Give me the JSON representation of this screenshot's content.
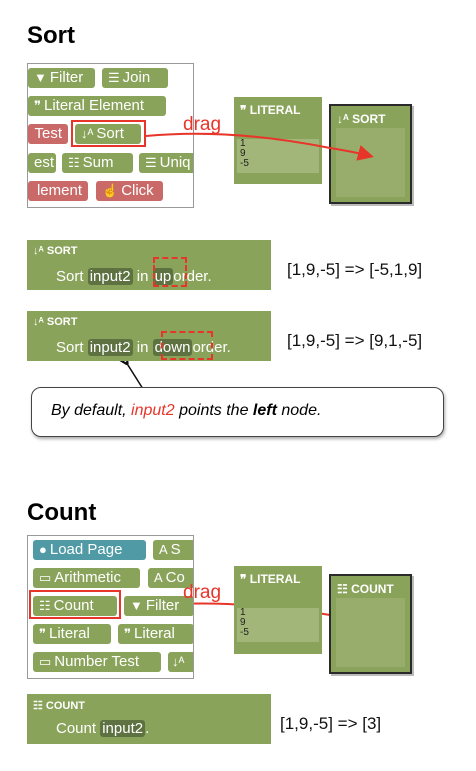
{
  "sort_section": {
    "heading": "Sort",
    "palette_items": [
      "Filter",
      "Join",
      "Literal Element",
      "Test",
      "Sort",
      "est",
      "Sum",
      "Uniq",
      "lement",
      "Click"
    ],
    "drag_label": "drag",
    "literal_node": {
      "title": "LITERAL",
      "values": [
        "1",
        "9",
        "-5"
      ]
    },
    "target_node": {
      "title": "SORT"
    },
    "op_up": {
      "title": "SORT",
      "prefix": "Sort",
      "input": "input2",
      "mid": "in",
      "order": "up",
      "suffix": "order.",
      "result": "[1,9,-5] => [-5,1,9]"
    },
    "op_down": {
      "title": "SORT",
      "prefix": "Sort",
      "input": "input2",
      "mid": "in",
      "order": "down",
      "suffix": "order.",
      "result": "[1,9,-5] => [9,1,-5]"
    },
    "callout": {
      "part1": "By default, ",
      "part2": "input2",
      "part3": " points the ",
      "part4": "left",
      "part5": " node."
    }
  },
  "count_section": {
    "heading": "Count",
    "palette_items": [
      "Load Page",
      "S",
      "Arithmetic",
      "Co",
      "Count",
      "Filter",
      "Literal",
      "Literal",
      "Number Test"
    ],
    "drag_label": "drag",
    "literal_node": {
      "title": "LITERAL",
      "values": [
        "1",
        "9",
        "-5"
      ]
    },
    "target_node": {
      "title": "COUNT"
    },
    "op_count": {
      "title": "COUNT",
      "prefix": "Count",
      "input": "input2",
      "suffix": ".",
      "result": "[1,9,-5] => [3]"
    }
  },
  "colors": {
    "block_green": "#8aa35a",
    "highlight_red": "#e8352a",
    "delete_red": "#c96a68",
    "web_teal": "#4f9aa5"
  },
  "icons": [
    "filter-icon",
    "join-icon",
    "quote-icon",
    "sort-icon",
    "sum-icon",
    "click-icon",
    "globe-icon",
    "text-icon",
    "arithmetic-icon",
    "count-icon"
  ]
}
